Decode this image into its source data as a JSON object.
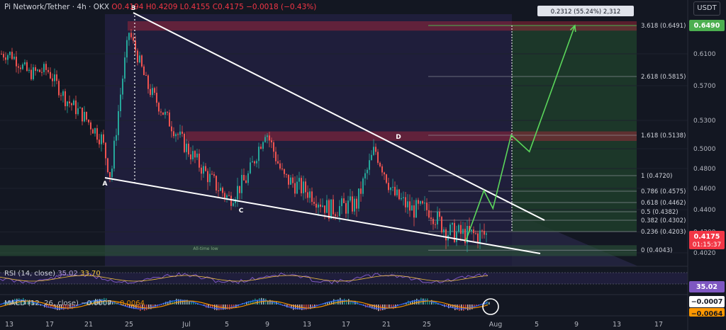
{
  "header": {
    "title": "Pi Network/Tether · 4h · OKX",
    "open": "O0.4194",
    "high": "H0.4209",
    "low": "L0.4155",
    "close": "C0.4175",
    "change": "−0.0018 (−0.43%)"
  },
  "currency_button": "USDT",
  "price_axis": [
    "0.6100",
    "0.5700",
    "0.5300",
    "0.5000",
    "0.4800",
    "0.4600",
    "0.4400",
    "0.4200",
    "0.4020"
  ],
  "date_axis": [
    "13",
    "17",
    "21",
    "25",
    "Jul",
    "5",
    "9",
    "13",
    "17",
    "21",
    "25",
    "Aug",
    "5",
    "9",
    "13",
    "17"
  ],
  "price_labels": {
    "target": "0.6490",
    "last": "0.4175",
    "countdown": "01:15:37",
    "rsi_value": "35.02",
    "macd_value": "−0.0007",
    "signal_value": "−0.0064"
  },
  "measure_label": "0.2312 (55.24%) 2,312",
  "fib_levels": [
    {
      "label": "3.618 (0.6491)",
      "price": 0.6491
    },
    {
      "label": "2.618 (0.5815)",
      "price": 0.5815
    },
    {
      "label": "1.618 (0.5138)",
      "price": 0.5138
    },
    {
      "label": "1 (0.4720)",
      "price": 0.472
    },
    {
      "label": "0.786 (0.4575)",
      "price": 0.4575
    },
    {
      "label": "0.618 (0.4462)",
      "price": 0.4462
    },
    {
      "label": "0.5 (0.4382)",
      "price": 0.4382
    },
    {
      "label": "0.382 (0.4302)",
      "price": 0.4302
    },
    {
      "label": "0.236 (0.4203)",
      "price": 0.4203
    },
    {
      "label": "0 (0.4043)",
      "price": 0.4043
    }
  ],
  "pattern_points": [
    "A",
    "B",
    "C",
    "D"
  ],
  "annotation": "All-time low",
  "rsi_header": {
    "label": "RSI (14, close)",
    "rsi": "35.02",
    "ma": "33.70"
  },
  "macd_header": {
    "label": "MACD (12, 26, close)",
    "hist": "−0.0007",
    "signal": "−0.0064"
  },
  "colors": {
    "background": "#131722",
    "up": "#26a69a",
    "down": "#ef5350",
    "wedge": "#ffffff",
    "projection": "#5bd65b",
    "target_badge": "#4caf50",
    "last_badge": "#f23645",
    "rsi_badge": "#7e57c2",
    "resistance": "#b2283c"
  },
  "chart_data": {
    "type": "candlestick",
    "title": "Pi Network/Tether · 4h · OKX",
    "ylabel": "USDT",
    "ylim": [
      0.396,
      0.665
    ],
    "x_ticks": [
      "13",
      "17",
      "21",
      "25",
      "Jul",
      "5",
      "9",
      "13",
      "17",
      "21",
      "25",
      "Aug",
      "5",
      "9",
      "13",
      "17"
    ],
    "price_path": [
      {
        "date": "Jun 12",
        "price": 0.61
      },
      {
        "date": "Jun 14",
        "price": 0.585
      },
      {
        "date": "Jun 16",
        "price": 0.59
      },
      {
        "date": "Jun 18",
        "price": 0.555
      },
      {
        "date": "Jun 20",
        "price": 0.535
      },
      {
        "date": "Jun 22",
        "price": 0.51
      },
      {
        "date": "Jun 23",
        "price": 0.47
      },
      {
        "date": "Jun 25",
        "price": 0.64
      },
      {
        "date": "Jun 27",
        "price": 0.57
      },
      {
        "date": "Jun 29",
        "price": 0.535
      },
      {
        "date": "Jul 1",
        "price": 0.505
      },
      {
        "date": "Jul 4",
        "price": 0.468
      },
      {
        "date": "Jul 6",
        "price": 0.45
      },
      {
        "date": "Jul 8",
        "price": 0.47
      },
      {
        "date": "Jul 10",
        "price": 0.52
      },
      {
        "date": "Jul 12",
        "price": 0.47
      },
      {
        "date": "Jul 15",
        "price": 0.455
      },
      {
        "date": "Jul 17",
        "price": 0.44
      },
      {
        "date": "Jul 20",
        "price": 0.445
      },
      {
        "date": "Jul 22",
        "price": 0.5
      },
      {
        "date": "Jul 24",
        "price": 0.455
      },
      {
        "date": "Jul 26",
        "price": 0.44
      },
      {
        "date": "Jul 28",
        "price": 0.44
      },
      {
        "date": "Jul 30",
        "price": 0.42
      },
      {
        "date": "Aug 1",
        "price": 0.4175
      }
    ],
    "pattern": {
      "A": 0.472,
      "B": 0.654,
      "C": 0.452,
      "D": 0.505
    },
    "projection": [
      {
        "date": "Aug 1",
        "price": 0.412
      },
      {
        "date": "Aug 3",
        "price": 0.458
      },
      {
        "date": "Aug 4",
        "price": 0.441
      },
      {
        "date": "Aug 6",
        "price": 0.514
      },
      {
        "date": "Aug 8",
        "price": 0.497
      },
      {
        "date": "Aug 13",
        "price": 0.649
      }
    ],
    "fib_extension": [
      0.4043,
      0.4203,
      0.4302,
      0.4382,
      0.4462,
      0.4575,
      0.472,
      0.5138,
      0.5815,
      0.6491
    ],
    "resistance_zones": [
      [
        0.642,
        0.655
      ],
      [
        0.508,
        0.518
      ]
    ],
    "support_zone": [
      0.4035,
      0.4055
    ],
    "rsi": {
      "value": 35.02,
      "ma": 33.7
    },
    "macd": {
      "macd": -0.0007,
      "signal": -0.0064
    }
  }
}
